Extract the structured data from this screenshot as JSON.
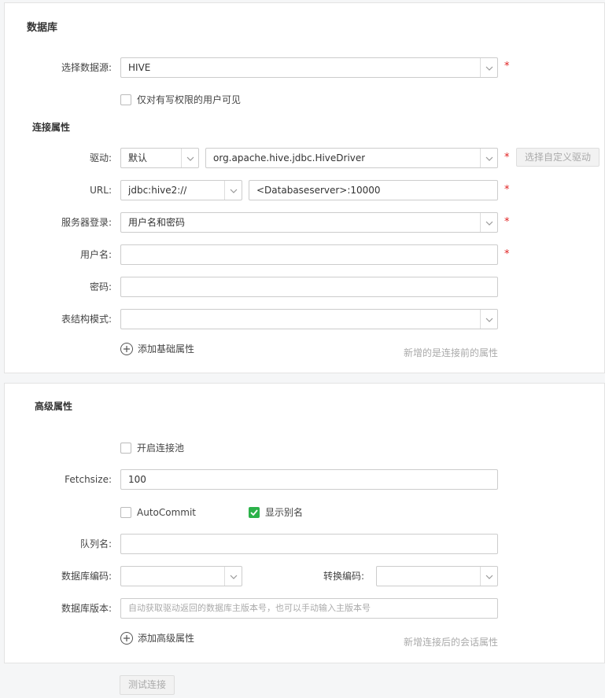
{
  "database_panel": {
    "title": "数据库",
    "datasource": {
      "label": "选择数据源:",
      "value": "HIVE"
    },
    "writable_only": {
      "label": "仅对有写权限的用户可见",
      "checked": false
    },
    "connection": {
      "section_title": "连接属性",
      "driver": {
        "label": "驱动:",
        "mode_value": "默认",
        "class_value": "org.apache.hive.jdbc.HiveDriver",
        "custom_button": "选择自定义驱动"
      },
      "url": {
        "label": "URL:",
        "prefix_value": "jdbc:hive2://",
        "address_value": "<Databaseserver>:10000"
      },
      "server_login": {
        "label": "服务器登录:",
        "value": "用户名和密码"
      },
      "username": {
        "label": "用户名:",
        "value": ""
      },
      "password": {
        "label": "密码:",
        "value": ""
      },
      "schema": {
        "label": "表结构模式:",
        "value": ""
      },
      "add_basic": "添加基础属性",
      "basic_hint": "新增的是连接前的属性"
    },
    "required_mark": "*"
  },
  "advanced_panel": {
    "title": "高级属性",
    "pool": {
      "label": "开启连接池",
      "checked": false
    },
    "fetchsize": {
      "label": "Fetchsize:",
      "value": "100"
    },
    "autocommit": {
      "label": "AutoCommit",
      "checked": false
    },
    "show_alias": {
      "label": "显示别名",
      "checked": true
    },
    "queue": {
      "label": "队列名:",
      "value": ""
    },
    "db_encoding": {
      "label": "数据库编码:",
      "value": ""
    },
    "convert_encoding": {
      "label": "转换编码:",
      "value": ""
    },
    "db_version": {
      "label": "数据库版本:",
      "placeholder": "自动获取驱动返回的数据库主版本号，也可以手动输入主版本号"
    },
    "add_advanced": "添加高级属性",
    "advanced_hint": "新增连接后的会话属性"
  },
  "footer": {
    "test_button": "测试连接"
  },
  "icons": {
    "dropdown": "chevron-down-icon",
    "add": "plus-circle-icon",
    "check": "check-icon"
  },
  "colors": {
    "required": "#e02020",
    "checkbox_checked": "#2cb24a"
  }
}
